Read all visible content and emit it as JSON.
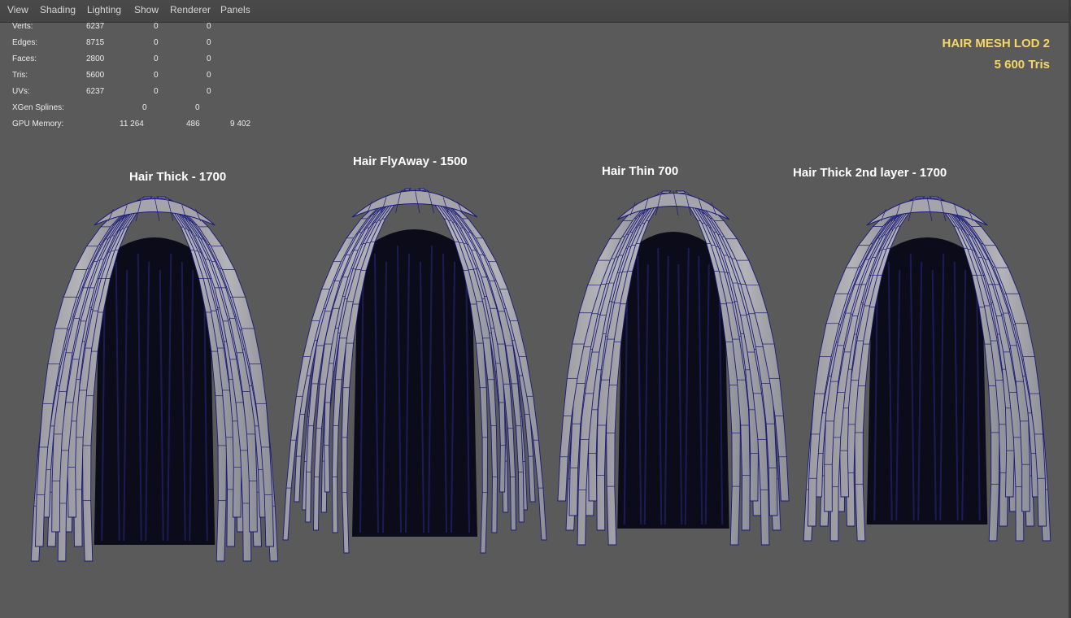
{
  "menu": [
    "View",
    "Shading",
    "Lighting",
    "Show",
    "Renderer",
    "Panels"
  ],
  "hud": [
    {
      "label": "Verts:",
      "v1": "6237",
      "v2": "0",
      "v3": "0"
    },
    {
      "label": "Edges:",
      "v1": "8715",
      "v2": "0",
      "v3": "0"
    },
    {
      "label": "Faces:",
      "v1": "2800",
      "v2": "0",
      "v3": "0"
    },
    {
      "label": "Tris:",
      "v1": "5600",
      "v2": "0",
      "v3": "0"
    },
    {
      "label": "UVs:",
      "v1": "6237",
      "v2": "0",
      "v3": "0"
    },
    {
      "label": "XGen Splines:",
      "v1": "",
      "v2": "0",
      "v3": "0"
    },
    {
      "label": "GPU Memory:",
      "v1": "11 264",
      "v2": "486",
      "v3": "9 402"
    }
  ],
  "title": {
    "line1": "HAIR MESH LOD 2",
    "line2": "5 600 Tris"
  },
  "meshes": [
    {
      "label": "Hair Thick - 1700"
    },
    {
      "label": "Hair FlyAway - 1500"
    },
    {
      "label": "Hair Thin 700"
    },
    {
      "label": "Hair Thick 2nd layer - 1700"
    }
  ],
  "colors": {
    "viewport_bg": "#5a5a5a",
    "mesh_fill": "#a9a9ad",
    "wire": "#1a1a7a",
    "interior": "#0b0b1a",
    "title": "#f5d766"
  }
}
